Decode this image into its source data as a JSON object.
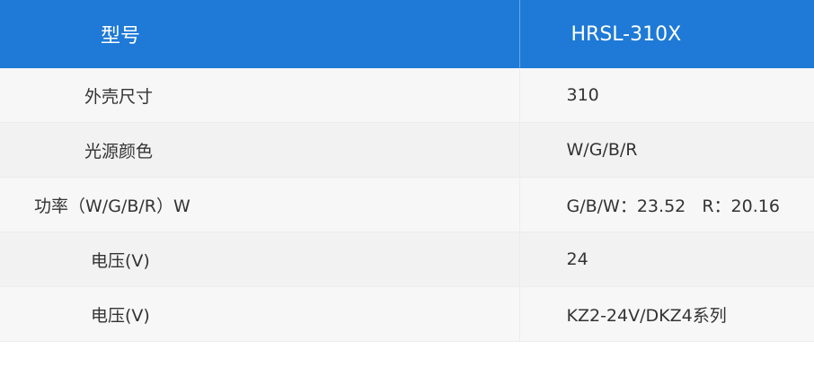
{
  "table": {
    "header": {
      "label": "型号",
      "value": "HRSL-310X"
    },
    "rows": [
      {
        "label": "外壳尺寸",
        "value": "310"
      },
      {
        "label": "光源颜色",
        "value": "W/G/B/R"
      },
      {
        "label": "功率（W/G/B/R）W",
        "value": "G/B/W：23.52   R：20.16"
      },
      {
        "label": "电压(V)",
        "value": "24"
      },
      {
        "label": "电压(V)",
        "value": "KZ2-24V/DKZ4系列"
      }
    ]
  },
  "colors": {
    "header_bg": "#1e7ad6",
    "header_text": "#ffffff",
    "row_odd": "#f7f7f7",
    "row_even": "#f2f2f2",
    "body_text": "#333333"
  }
}
